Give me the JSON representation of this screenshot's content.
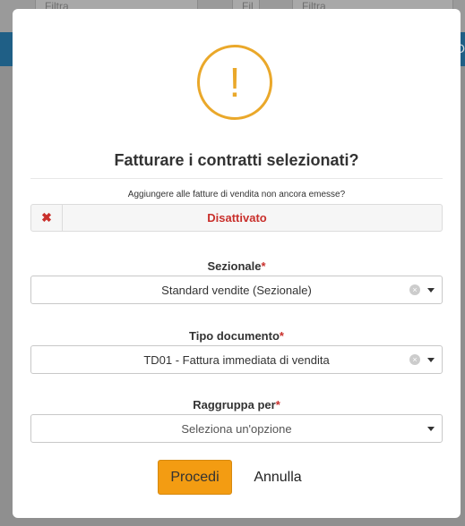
{
  "background": {
    "filters": [
      "Filtra",
      "Fil",
      "Filtra"
    ],
    "bar_text": "D"
  },
  "dialog": {
    "icon": "alert-exclamation-icon",
    "icon_glyph": "!",
    "title": "Fatturare i contratti selezionati?",
    "question": "Aggiungere alle fatture di vendita non ancora emesse?",
    "toggle": {
      "glyph": "✖",
      "label": "Disattivato"
    },
    "fields": [
      {
        "label": "Sezionale",
        "required": "*",
        "value": "Standard vendite (Sezionale)",
        "clear": "×"
      },
      {
        "label": "Tipo documento",
        "required": "*",
        "value": "TD01 - Fattura immediata di vendita",
        "clear": "×"
      },
      {
        "label": "Raggruppa per",
        "required": "*",
        "placeholder": "Seleziona un'opzione"
      }
    ],
    "buttons": {
      "primary": "Procedi",
      "cancel": "Annulla"
    }
  },
  "colors": {
    "accent": "#f39c12",
    "warning": "#eaa82a",
    "danger": "#c9302c",
    "bar": "#1f5f86"
  }
}
